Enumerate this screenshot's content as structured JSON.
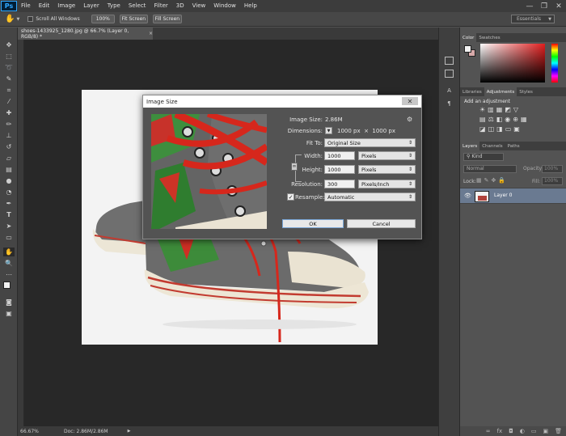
{
  "app": {
    "logo": "Ps",
    "brand_color": "#31a8ff"
  },
  "menu": [
    "File",
    "Edit",
    "Image",
    "Layer",
    "Type",
    "Select",
    "Filter",
    "3D",
    "View",
    "Window",
    "Help"
  ],
  "window_controls": {
    "minimize": "—",
    "restore": "❐",
    "close": "✕"
  },
  "options_bar": {
    "scroll_all_label": "Scroll All Windows",
    "zoom_100": "100%",
    "fit_screen": "Fit Screen",
    "fill_screen": "Fill Screen",
    "workspace": "Essentials"
  },
  "document": {
    "tab_title": "shoes-1433925_1280.jpg @ 66.7% (Layer 0, RGB/8) *",
    "close_glyph": "×",
    "zoom": "66.67%",
    "doc_info": "Doc: 2.86M/2.86M"
  },
  "dialog": {
    "title": "Image Size",
    "close_glyph": "✕",
    "image_size_label": "Image Size:",
    "image_size_value": "2.86M",
    "dimensions_label": "Dimensions:",
    "dimensions_value": "1000 px  ×  1000 px",
    "fit_to_label": "Fit To:",
    "fit_to_value": "Original Size",
    "width_label": "Width:",
    "width_value": "1000",
    "width_unit": "Pixels",
    "height_label": "Height:",
    "height_value": "1000",
    "height_unit": "Pixels",
    "resolution_label": "Resolution:",
    "resolution_value": "300",
    "resolution_unit": "Pixels/Inch",
    "resample_label": "Resample:",
    "resample_value": "Automatic",
    "resample_checked": true,
    "ok_label": "OK",
    "cancel_label": "Cancel"
  },
  "panels": {
    "color_tabs": [
      "Color",
      "Swatches"
    ],
    "adjust_tabs": [
      "Libraries",
      "Adjustments",
      "Styles"
    ],
    "add_adjustment": "Add an adjustment",
    "layers_tabs": [
      "Layers",
      "Channels",
      "Paths"
    ],
    "kind_label": "Kind",
    "blend_mode": "Normal",
    "opacity_label": "Opacity:",
    "opacity_value": "100%",
    "lock_label": "Lock:",
    "fill_label": "Fill:",
    "fill_value": "100%",
    "layer_name": "Layer 0"
  },
  "colors": {
    "foreground": "#f2f2f2",
    "background": "#d7a9a9",
    "picker_hue": "#e21e1e",
    "layer_selected": "#6a7a91",
    "shoe_red": "#d6271c"
  }
}
